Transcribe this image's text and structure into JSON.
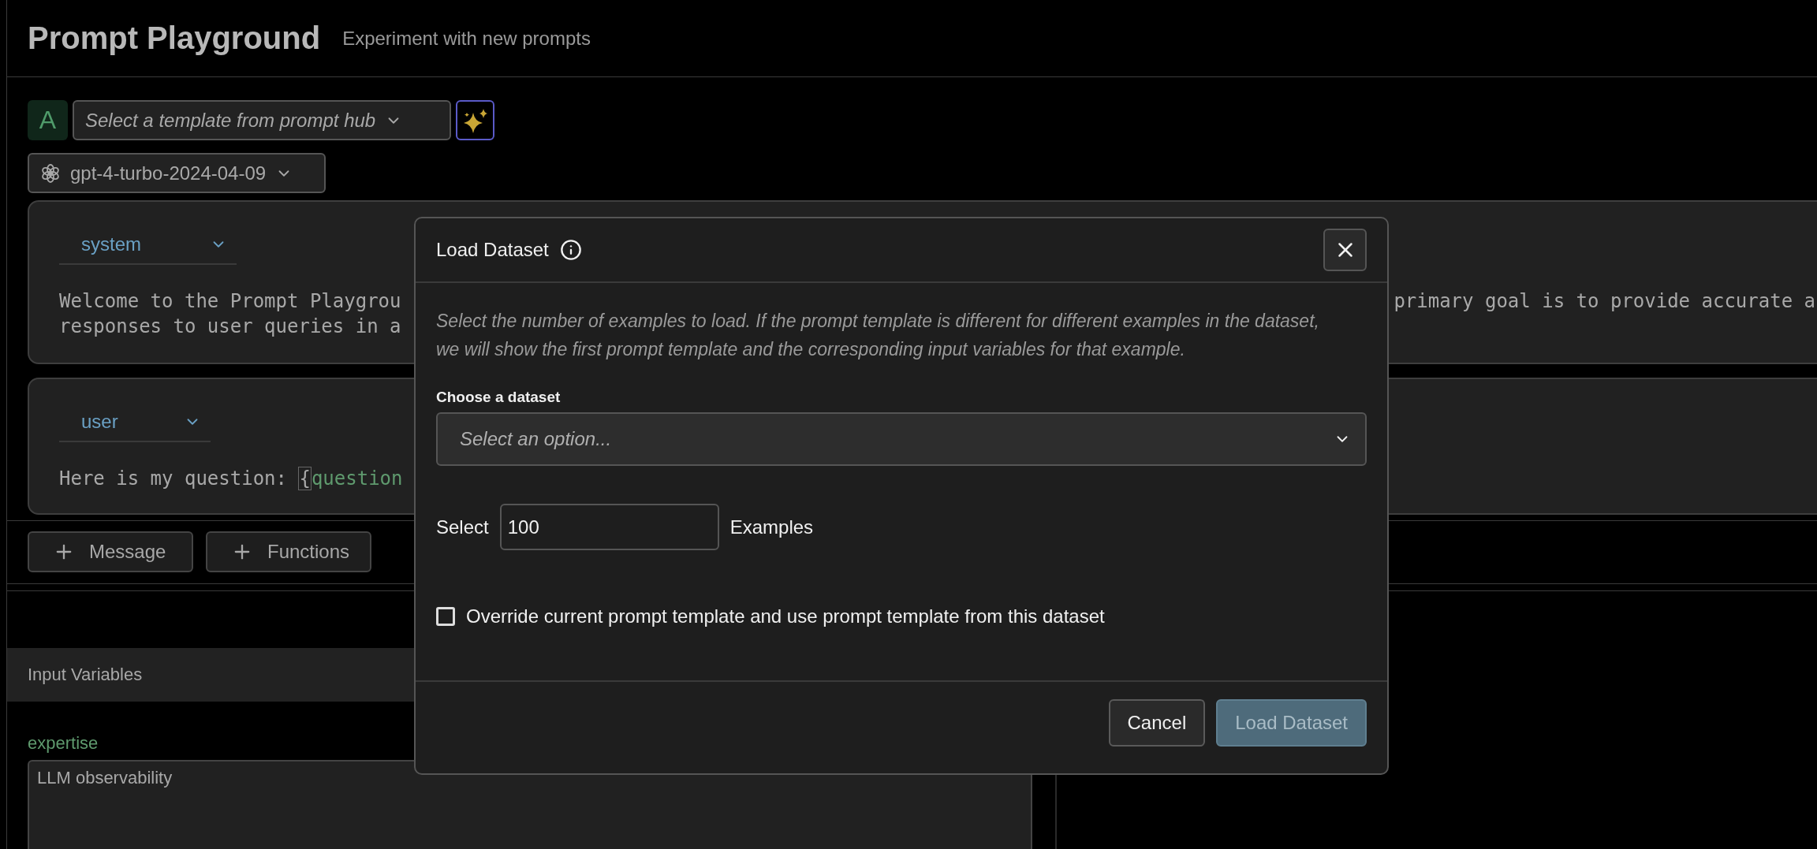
{
  "header": {
    "title": "Prompt Playground",
    "subtitle": "Experiment with new prompts"
  },
  "toolbar": {
    "avatar": "A",
    "template_select": {
      "placeholder": "Select a template from prompt hub"
    },
    "model_select": {
      "value": "gpt-4-turbo-2024-04-09"
    }
  },
  "messages": [
    {
      "role": "system",
      "lines": [
        {
          "left": "Welcome to the Prompt Playgrou",
          "right": "primary goal is to provide accurate a"
        },
        {
          "left": "responses to user queries in a"
        }
      ]
    },
    {
      "role": "user",
      "lines": [
        {
          "left": "Here is my question: ",
          "brace": "{",
          "variable": "question"
        }
      ]
    }
  ],
  "add_buttons": [
    "Message",
    "Functions"
  ],
  "input_variables": {
    "title": "Input Variables",
    "variables": [
      {
        "name": "expertise",
        "value": "LLM observability"
      }
    ]
  },
  "dialog": {
    "title": "Load Dataset",
    "description": "Select the number of examples to load. If the prompt template is different for different examples in the dataset, we will show the first prompt template and the corresponding input variables for that example.",
    "dataset_label": "Choose a dataset",
    "dataset_placeholder": "Select an option...",
    "count_prefix": "Select",
    "count_value": "100",
    "count_suffix": "Examples",
    "override": {
      "label": "Override current prompt template and use prompt template from this dataset",
      "checked": false
    },
    "buttons": [
      {
        "label": "Cancel",
        "kind": "secondary",
        "disabled": false
      },
      {
        "label": "Load Dataset",
        "kind": "primary",
        "disabled": true
      }
    ]
  }
}
